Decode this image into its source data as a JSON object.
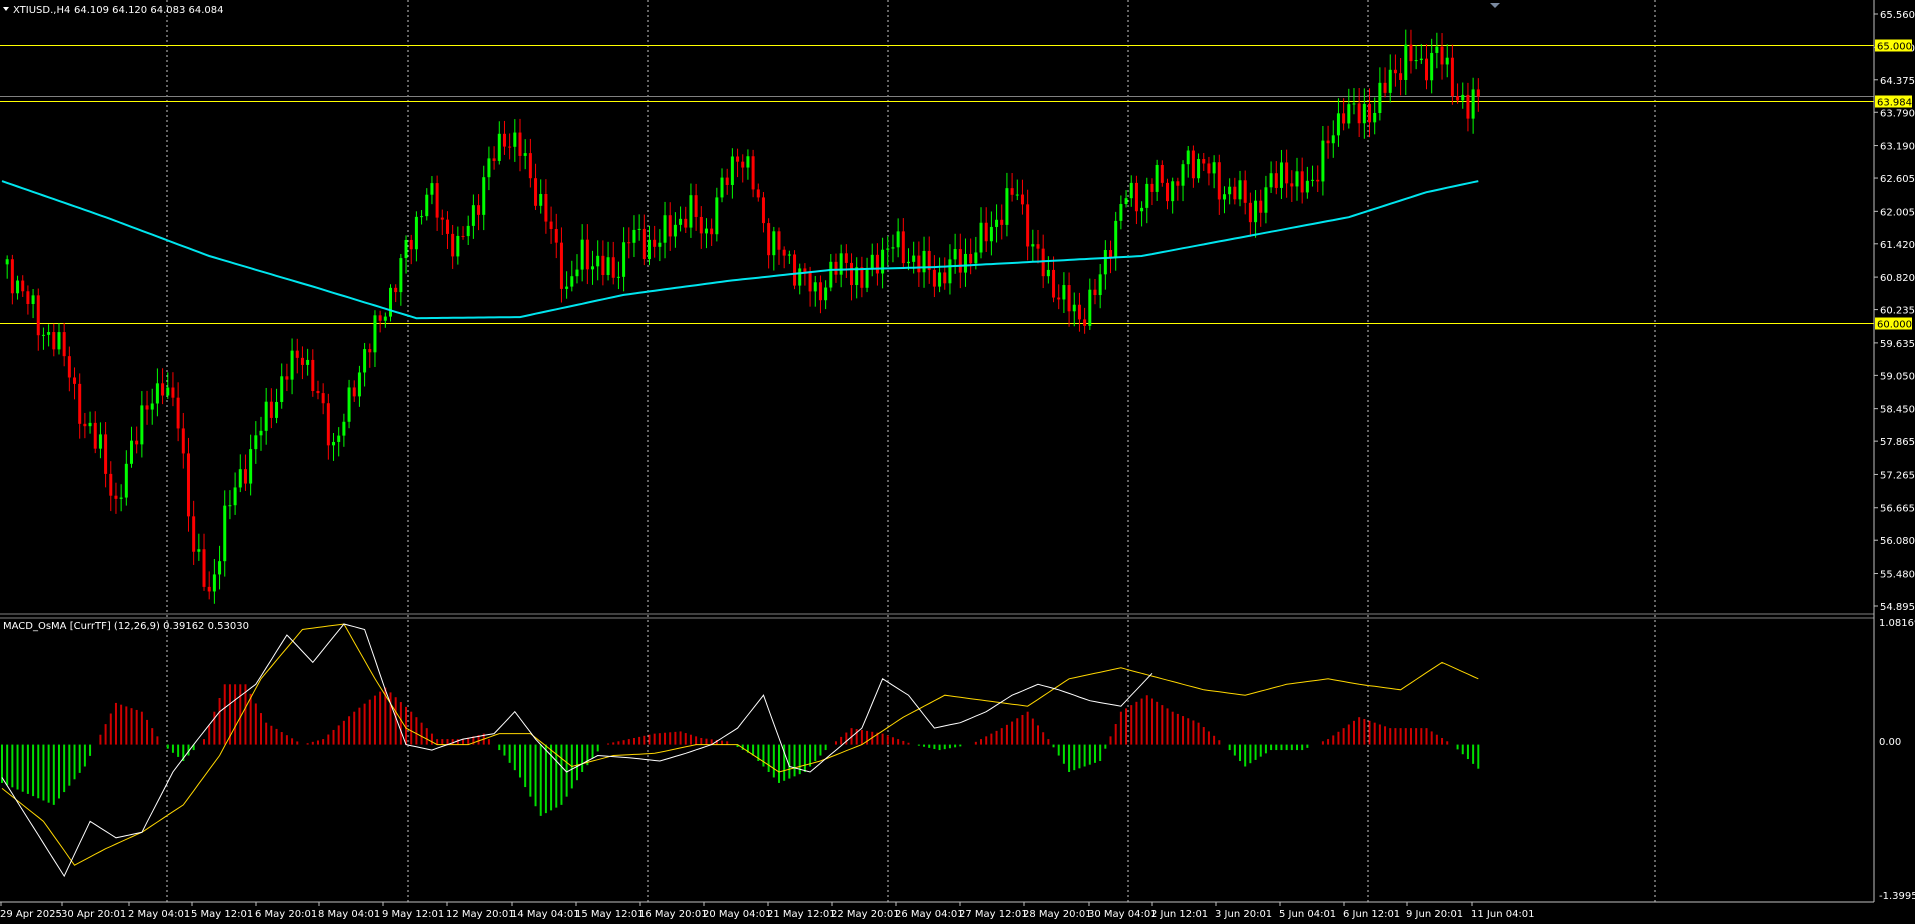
{
  "header": {
    "symbol": "XTIUSD.,H4",
    "ohlc": "64.109 64.120 64.083 64.084",
    "menu_icon": "triangle-down-icon"
  },
  "indicator": {
    "label": "MACD_OsMA [CurrTF] (12,26,9) 0.39162 0.53030",
    "scale_max": "1.08169",
    "scale_zero": "0.00",
    "scale_min": "-1.39953"
  },
  "price_axis": {
    "ticks": [
      "65.560",
      "64.960",
      "64.375",
      "63.790",
      "63.190",
      "62.605",
      "62.005",
      "61.420",
      "60.820",
      "60.235",
      "59.635",
      "59.050",
      "58.450",
      "57.865",
      "57.265",
      "56.665",
      "56.080",
      "55.480",
      "54.895"
    ]
  },
  "levels": [
    {
      "label": "65.000",
      "value": 65.0
    },
    {
      "label": "63.984",
      "value": 63.984
    },
    {
      "label": "60.000",
      "value": 60.0
    }
  ],
  "current_price_label": "64.084",
  "time_axis": {
    "labels": [
      "29 Apr 2025",
      "30 Apr 20:01",
      "2 May 04:01",
      "5 May 12:01",
      "6 May 20:01",
      "8 May 04:01",
      "9 May 12:01",
      "12 May 20:01",
      "14 May 04:01",
      "15 May 12:01",
      "16 May 20:01",
      "20 May 04:01",
      "21 May 12:01",
      "22 May 20:01",
      "26 May 04:01",
      "27 May 12:01",
      "28 May 20:01",
      "30 May 04:01",
      "2 Jun 12:01",
      "3 Jun 20:01",
      "5 Jun 04:01",
      "6 Jun 12:01",
      "9 Jun 20:01",
      "11 Jun 04:01"
    ]
  },
  "colors": {
    "background": "#000000",
    "bull": "#00ff00",
    "bear": "#ff0000",
    "ma_line": "#00e5ee",
    "level_line": "#ffff00",
    "macd_line": "#ffffff",
    "signal_line": "#ffd700",
    "hist_pos": "#d00000",
    "hist_neg": "#00e000",
    "grid": "#c8c8c8"
  },
  "chart_data": {
    "type": "candlestick",
    "title": "XTIUSD.,H4",
    "ylim": [
      54.895,
      65.56
    ],
    "grid": "vertical-dotted",
    "price_anchors": [
      [
        0,
        61.05
      ],
      [
        4,
        60.6
      ],
      [
        7,
        59.95
      ],
      [
        10,
        59.7
      ],
      [
        13,
        59.2
      ],
      [
        16,
        58.0
      ],
      [
        19,
        57.9
      ],
      [
        22,
        56.5
      ],
      [
        25,
        57.9
      ],
      [
        28,
        58.4
      ],
      [
        31,
        59.0
      ],
      [
        34,
        58.2
      ],
      [
        37,
        56.0
      ],
      [
        40,
        55.0
      ],
      [
        43,
        56.5
      ],
      [
        46,
        57.2
      ],
      [
        49,
        57.9
      ],
      [
        52,
        58.5
      ],
      [
        55,
        59.1
      ],
      [
        58,
        59.5
      ],
      [
        61,
        58.6
      ],
      [
        64,
        57.8
      ],
      [
        67,
        58.5
      ],
      [
        70,
        59.5
      ],
      [
        73,
        60.0
      ],
      [
        76,
        60.8
      ],
      [
        79,
        61.5
      ],
      [
        82,
        62.4
      ],
      [
        85,
        61.8
      ],
      [
        88,
        61.3
      ],
      [
        91,
        62.0
      ],
      [
        94,
        62.8
      ],
      [
        97,
        63.4
      ],
      [
        100,
        63.1
      ],
      [
        103,
        62.4
      ],
      [
        106,
        61.6
      ],
      [
        109,
        60.6
      ],
      [
        112,
        61.2
      ],
      [
        115,
        61.1
      ],
      [
        118,
        60.8
      ],
      [
        121,
        61.6
      ],
      [
        124,
        61.4
      ],
      [
        127,
        61.5
      ],
      [
        130,
        61.8
      ],
      [
        133,
        62.0
      ],
      [
        136,
        61.6
      ],
      [
        139,
        62.4
      ],
      [
        142,
        63.1
      ],
      [
        145,
        62.5
      ],
      [
        148,
        61.5
      ],
      [
        151,
        61.2
      ],
      [
        154,
        60.9
      ],
      [
        157,
        60.5
      ],
      [
        160,
        60.9
      ],
      [
        163,
        61.1
      ],
      [
        166,
        60.7
      ],
      [
        169,
        61.2
      ],
      [
        172,
        61.4
      ],
      [
        175,
        61.2
      ],
      [
        178,
        61.0
      ],
      [
        181,
        60.8
      ],
      [
        184,
        61.1
      ],
      [
        187,
        61.2
      ],
      [
        190,
        61.6
      ],
      [
        193,
        62.0
      ],
      [
        196,
        62.4
      ],
      [
        199,
        61.3
      ],
      [
        202,
        60.8
      ],
      [
        205,
        60.4
      ],
      [
        208,
        60.1
      ],
      [
        211,
        60.5
      ],
      [
        214,
        61.5
      ],
      [
        217,
        62.3
      ],
      [
        220,
        62.2
      ],
      [
        223,
        62.6
      ],
      [
        226,
        62.4
      ],
      [
        229,
        62.9
      ],
      [
        232,
        62.9
      ],
      [
        235,
        62.4
      ],
      [
        238,
        62.4
      ],
      [
        241,
        62.0
      ],
      [
        244,
        62.3
      ],
      [
        247,
        62.8
      ],
      [
        250,
        62.4
      ],
      [
        253,
        62.6
      ],
      [
        256,
        63.2
      ],
      [
        259,
        63.9
      ],
      [
        262,
        63.7
      ],
      [
        265,
        63.9
      ],
      [
        268,
        64.4
      ],
      [
        271,
        64.8
      ],
      [
        274,
        64.6
      ],
      [
        277,
        64.9
      ],
      [
        280,
        64.3
      ],
      [
        283,
        63.8
      ],
      [
        285,
        64.08
      ]
    ],
    "ma_anchors": [
      [
        0,
        62.55
      ],
      [
        20,
        61.9
      ],
      [
        40,
        61.2
      ],
      [
        60,
        60.65
      ],
      [
        80,
        60.08
      ],
      [
        100,
        60.1
      ],
      [
        120,
        60.5
      ],
      [
        140,
        60.75
      ],
      [
        160,
        60.95
      ],
      [
        180,
        61.0
      ],
      [
        200,
        61.1
      ],
      [
        220,
        61.2
      ],
      [
        240,
        61.55
      ],
      [
        260,
        61.9
      ],
      [
        275,
        62.35
      ],
      [
        285,
        62.55
      ]
    ],
    "osma_anchors": [
      [
        0,
        -0.35
      ],
      [
        10,
        -0.55
      ],
      [
        16,
        -0.2
      ],
      [
        22,
        0.38
      ],
      [
        27,
        0.3
      ],
      [
        31,
        0.0
      ],
      [
        35,
        -0.15
      ],
      [
        39,
        0.05
      ],
      [
        43,
        0.55
      ],
      [
        47,
        0.55
      ],
      [
        51,
        0.2
      ],
      [
        58,
        0.0
      ],
      [
        62,
        0.05
      ],
      [
        68,
        0.3
      ],
      [
        74,
        0.52
      ],
      [
        79,
        0.3
      ],
      [
        84,
        0.05
      ],
      [
        89,
        0.05
      ],
      [
        93,
        0.1
      ],
      [
        97,
        -0.1
      ],
      [
        100,
        -0.3
      ],
      [
        104,
        -0.65
      ],
      [
        108,
        -0.55
      ],
      [
        112,
        -0.25
      ],
      [
        116,
        0.0
      ],
      [
        121,
        0.05
      ],
      [
        126,
        0.1
      ],
      [
        131,
        0.12
      ],
      [
        135,
        0.06
      ],
      [
        140,
        0.03
      ],
      [
        145,
        -0.1
      ],
      [
        150,
        -0.35
      ],
      [
        155,
        -0.25
      ],
      [
        159,
        -0.05
      ],
      [
        164,
        0.15
      ],
      [
        170,
        0.1
      ],
      [
        176,
        0.0
      ],
      [
        181,
        -0.05
      ],
      [
        187,
        0.0
      ],
      [
        193,
        0.15
      ],
      [
        198,
        0.3
      ],
      [
        202,
        0.05
      ],
      [
        206,
        -0.25
      ],
      [
        212,
        -0.15
      ],
      [
        216,
        0.3
      ],
      [
        221,
        0.45
      ],
      [
        226,
        0.3
      ],
      [
        231,
        0.2
      ],
      [
        236,
        0.0
      ],
      [
        240,
        -0.2
      ],
      [
        245,
        -0.05
      ],
      [
        251,
        -0.05
      ],
      [
        256,
        0.05
      ],
      [
        262,
        0.25
      ],
      [
        268,
        0.15
      ],
      [
        275,
        0.15
      ],
      [
        280,
        0.0
      ],
      [
        285,
        -0.22
      ]
    ],
    "macd_anchors": [
      [
        0,
        -0.3
      ],
      [
        8,
        -0.9
      ],
      [
        12,
        -1.2
      ],
      [
        17,
        -0.7
      ],
      [
        22,
        -0.85
      ],
      [
        27,
        -0.8
      ],
      [
        33,
        -0.25
      ],
      [
        37,
        0.0
      ],
      [
        42,
        0.3
      ],
      [
        49,
        0.55
      ],
      [
        55,
        1.0
      ],
      [
        60,
        0.75
      ],
      [
        66,
        1.1
      ],
      [
        70,
        1.05
      ],
      [
        74,
        0.5
      ],
      [
        78,
        0.0
      ],
      [
        83,
        -0.05
      ],
      [
        89,
        0.05
      ],
      [
        95,
        0.1
      ],
      [
        99,
        0.3
      ],
      [
        103,
        0.05
      ],
      [
        109,
        -0.25
      ],
      [
        115,
        -0.1
      ],
      [
        121,
        -0.12
      ],
      [
        127,
        -0.15
      ],
      [
        132,
        -0.08
      ],
      [
        137,
        0.0
      ],
      [
        142,
        0.15
      ],
      [
        147,
        0.45
      ],
      [
        152,
        -0.2
      ],
      [
        156,
        -0.25
      ],
      [
        161,
        -0.05
      ],
      [
        166,
        0.15
      ],
      [
        170,
        0.6
      ],
      [
        175,
        0.45
      ],
      [
        180,
        0.15
      ],
      [
        185,
        0.2
      ],
      [
        190,
        0.3
      ],
      [
        195,
        0.45
      ],
      [
        200,
        0.55
      ],
      [
        204,
        0.5
      ],
      [
        210,
        0.4
      ],
      [
        216,
        0.35
      ],
      [
        222,
        0.65
      ]
    ],
    "signal_anchors": [
      [
        0,
        -0.4
      ],
      [
        8,
        -0.7
      ],
      [
        14,
        -1.1
      ],
      [
        20,
        -0.95
      ],
      [
        27,
        -0.8
      ],
      [
        35,
        -0.55
      ],
      [
        42,
        -0.1
      ],
      [
        50,
        0.6
      ],
      [
        58,
        1.05
      ],
      [
        66,
        1.1
      ],
      [
        72,
        0.6
      ],
      [
        78,
        0.15
      ],
      [
        84,
        0.0
      ],
      [
        90,
        0.0
      ],
      [
        96,
        0.1
      ],
      [
        102,
        0.1
      ],
      [
        110,
        -0.2
      ],
      [
        118,
        -0.1
      ],
      [
        126,
        -0.08
      ],
      [
        134,
        0.0
      ],
      [
        142,
        0.0
      ],
      [
        150,
        -0.25
      ],
      [
        158,
        -0.15
      ],
      [
        166,
        0.0
      ],
      [
        174,
        0.25
      ],
      [
        182,
        0.45
      ],
      [
        190,
        0.4
      ],
      [
        198,
        0.35
      ],
      [
        206,
        0.6
      ],
      [
        216,
        0.7
      ],
      [
        224,
        0.6
      ],
      [
        232,
        0.5
      ],
      [
        240,
        0.45
      ],
      [
        248,
        0.55
      ],
      [
        256,
        0.6
      ],
      [
        262,
        0.55
      ],
      [
        270,
        0.5
      ],
      [
        278,
        0.75
      ],
      [
        285,
        0.6
      ]
    ],
    "macd_ylim": [
      -1.39953,
      1.08169
    ]
  }
}
